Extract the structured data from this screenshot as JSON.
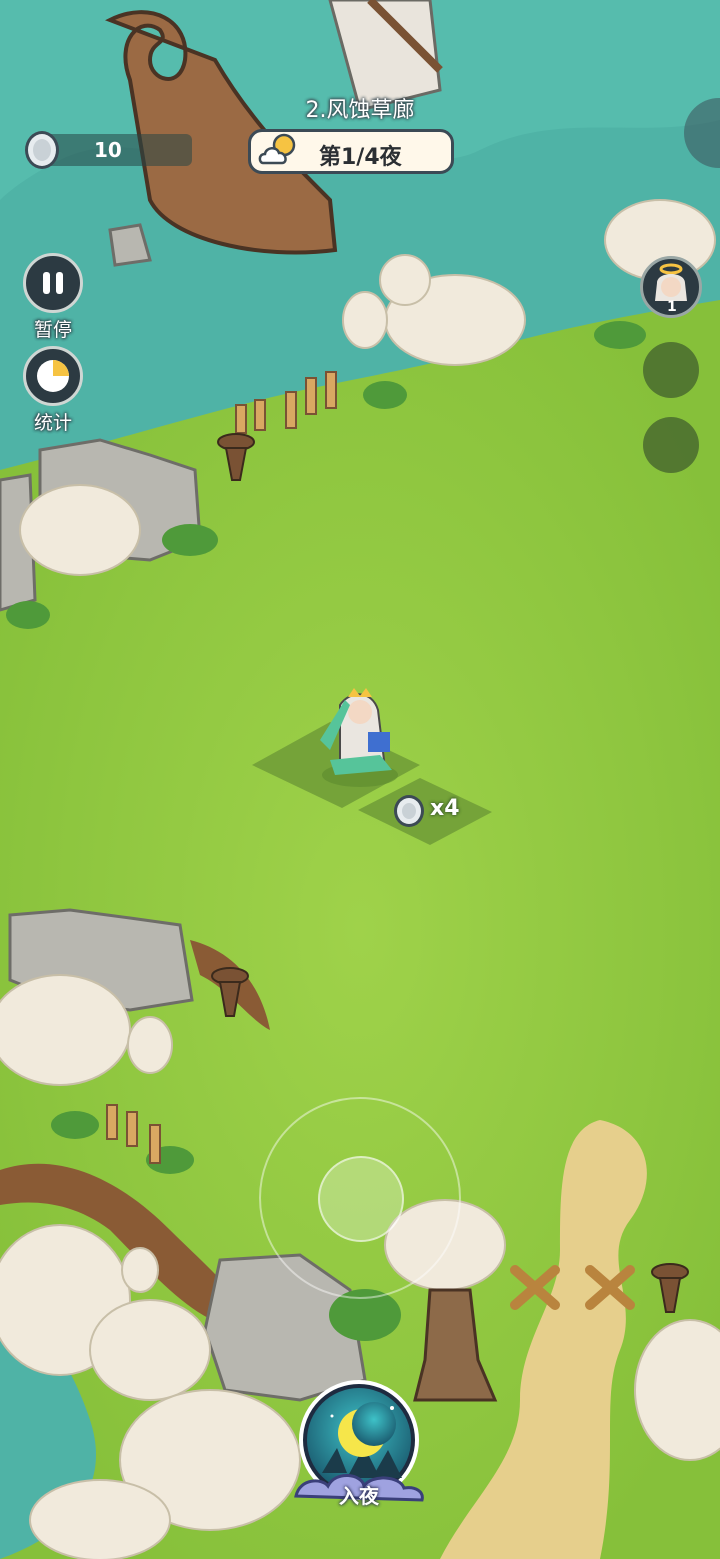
{
  "hud": {
    "coins": "10",
    "level_title": "2.风蚀草廊",
    "night_progress": "第1/4夜",
    "weather_icon": "cloud-sun-icon"
  },
  "side_buttons": {
    "pause_label": "暂停",
    "stats_label": "统计"
  },
  "right_panel": {
    "hero_count": "1"
  },
  "tile": {
    "coin_multiplier": "x4"
  },
  "actions": {
    "enter_night_label": "入夜"
  },
  "colors": {
    "water": "#4fb3a6",
    "grass": "#8cc63f",
    "grass_dark": "#79b235",
    "hud_dark": "#2c3a42",
    "pill_bg": "#fff8ea"
  }
}
